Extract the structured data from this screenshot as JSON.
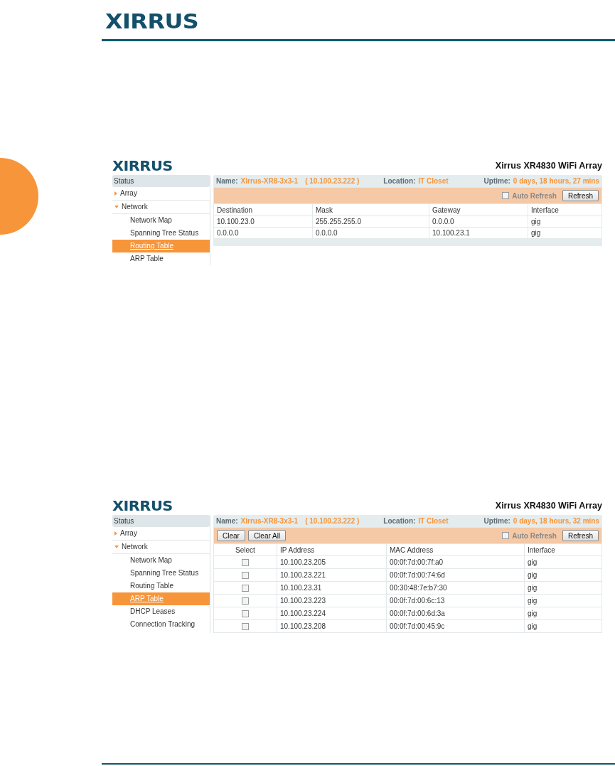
{
  "page": {
    "logo": "XIRRUS"
  },
  "screenshots": [
    {
      "logo": "XIRRUS",
      "title": "Xirrus XR4830 WiFi Array",
      "status": {
        "name_label": "Name:",
        "name_value": "Xirrus-XR8-3x3-1",
        "ip": "( 10.100.23.222 )",
        "location_label": "Location:",
        "location_value": "IT Closet",
        "uptime_label": "Uptime:",
        "uptime_value": "0 days, 18 hours, 27 mins"
      },
      "sidebar": {
        "header": "Status",
        "items": [
          {
            "label": "Array",
            "expanded": false
          },
          {
            "label": "Network",
            "expanded": true,
            "children": [
              {
                "label": "Network Map",
                "selected": false
              },
              {
                "label": "Spanning Tree Status",
                "selected": false
              },
              {
                "label": "Routing Table",
                "selected": true
              },
              {
                "label": "ARP Table",
                "selected": false
              }
            ]
          }
        ]
      },
      "toolbar": {
        "auto_refresh": {
          "label": "Auto Refresh",
          "checked": false
        },
        "refresh": "Refresh"
      },
      "table": {
        "columns": [
          "Destination",
          "Mask",
          "Gateway",
          "Interface"
        ],
        "rows": [
          {
            "cells": [
              "10.100.23.0",
              "255.255.255.0",
              "0.0.0.0",
              "gig"
            ]
          },
          {
            "cells": [
              "0.0.0.0",
              "0.0.0.0",
              "10.100.23.1",
              "gig"
            ]
          }
        ]
      }
    },
    {
      "logo": "XIRRUS",
      "title": "Xirrus XR4830 WiFi Array",
      "status": {
        "name_label": "Name:",
        "name_value": "Xirrus-XR8-3x3-1",
        "ip": "( 10.100.23.222 )",
        "location_label": "Location:",
        "location_value": "IT Closet",
        "uptime_label": "Uptime:",
        "uptime_value": "0 days, 18 hours, 32 mins"
      },
      "sidebar": {
        "header": "Status",
        "items": [
          {
            "label": "Array",
            "expanded": false
          },
          {
            "label": "Network",
            "expanded": true,
            "children": [
              {
                "label": "Network Map",
                "selected": false
              },
              {
                "label": "Spanning Tree Status",
                "selected": false
              },
              {
                "label": "Routing Table",
                "selected": false
              },
              {
                "label": "ARP Table",
                "selected": true
              },
              {
                "label": "DHCP Leases",
                "selected": false
              },
              {
                "label": "Connection Tracking",
                "selected": false
              }
            ]
          }
        ]
      },
      "toolbar": {
        "buttons": [
          "Clear",
          "Clear All"
        ],
        "auto_refresh": {
          "label": "Auto Refresh",
          "checked": false
        },
        "refresh": "Refresh"
      },
      "table": {
        "columns": [
          "Select",
          "IP Address",
          "MAC Address",
          "Interface"
        ],
        "rows": [
          {
            "checked": false,
            "cells": [
              "",
              "10.100.23.205",
              "00:0f:7d:00:7f:a0",
              "gig"
            ]
          },
          {
            "checked": false,
            "cells": [
              "",
              "10.100.23.221",
              "00:0f:7d:00:74:6d",
              "gig"
            ]
          },
          {
            "checked": false,
            "cells": [
              "",
              "10.100.23.31",
              "00:30:48:7e:b7:30",
              "gig"
            ]
          },
          {
            "checked": false,
            "cells": [
              "",
              "10.100.23.223",
              "00:0f:7d:00:6c:13",
              "gig"
            ]
          },
          {
            "checked": false,
            "cells": [
              "",
              "10.100.23.224",
              "00:0f:7d:00:6d:3a",
              "gig"
            ]
          },
          {
            "checked": false,
            "cells": [
              "",
              "10.100.23.208",
              "00:0f:7d:00:45:9c",
              "gig"
            ]
          }
        ]
      }
    }
  ]
}
